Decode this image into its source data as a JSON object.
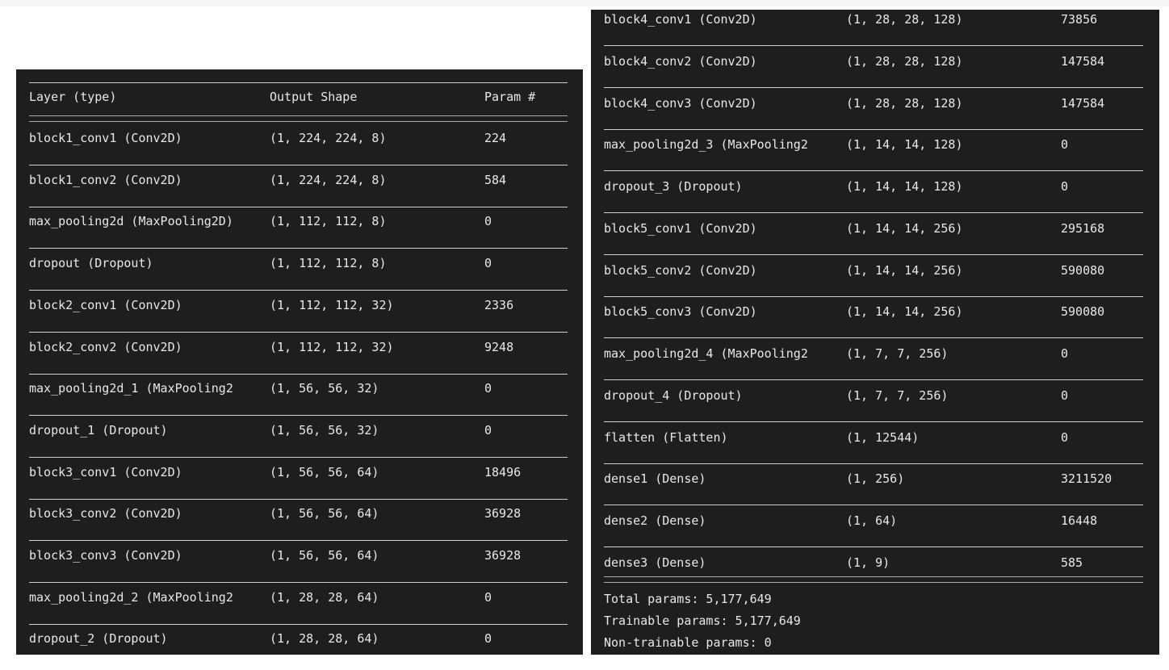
{
  "left_panel": {
    "headers": [
      "Layer (type)",
      "Output Shape",
      "Param #"
    ],
    "rows": [
      [
        "block1_conv1 (Conv2D)",
        "(1, 224, 224, 8)",
        "224"
      ],
      [
        "block1_conv2 (Conv2D)",
        "(1, 224, 224, 8)",
        "584"
      ],
      [
        "max_pooling2d (MaxPooling2D)",
        "(1, 112, 112, 8)",
        "0"
      ],
      [
        "dropout (Dropout)",
        "(1, 112, 112, 8)",
        "0"
      ],
      [
        "block2_conv1 (Conv2D)",
        "(1, 112, 112, 32)",
        "2336"
      ],
      [
        "block2_conv2 (Conv2D)",
        "(1, 112, 112, 32)",
        "9248"
      ],
      [
        "max_pooling2d_1 (MaxPooling2",
        "(1, 56, 56, 32)",
        "0"
      ],
      [
        "dropout_1 (Dropout)",
        "(1, 56, 56, 32)",
        "0"
      ],
      [
        "block3_conv1 (Conv2D)",
        "(1, 56, 56, 64)",
        "18496"
      ],
      [
        "block3_conv2 (Conv2D)",
        "(1, 56, 56, 64)",
        "36928"
      ],
      [
        "block3_conv3 (Conv2D)",
        "(1, 56, 56, 64)",
        "36928"
      ],
      [
        "max_pooling2d_2 (MaxPooling2",
        "(1, 28, 28, 64)",
        "0"
      ],
      [
        "dropout_2 (Dropout)",
        "(1, 28, 28, 64)",
        "0"
      ]
    ]
  },
  "right_panel": {
    "rows": [
      [
        "block4_conv1 (Conv2D)",
        "(1, 28, 28, 128)",
        "73856"
      ],
      [
        "block4_conv2 (Conv2D)",
        "(1, 28, 28, 128)",
        "147584"
      ],
      [
        "block4_conv3 (Conv2D)",
        "(1, 28, 28, 128)",
        "147584"
      ],
      [
        "max_pooling2d_3 (MaxPooling2",
        "(1, 14, 14, 128)",
        "0"
      ],
      [
        "dropout_3 (Dropout)",
        "(1, 14, 14, 128)",
        "0"
      ],
      [
        "block5_conv1 (Conv2D)",
        "(1, 14, 14, 256)",
        "295168"
      ],
      [
        "block5_conv2 (Conv2D)",
        "(1, 14, 14, 256)",
        "590080"
      ],
      [
        "block5_conv3 (Conv2D)",
        "(1, 14, 14, 256)",
        "590080"
      ],
      [
        "max_pooling2d_4 (MaxPooling2",
        "(1, 7, 7, 256)",
        "0"
      ],
      [
        "dropout_4 (Dropout)",
        "(1, 7, 7, 256)",
        "0"
      ],
      [
        "flatten (Flatten)",
        "(1, 12544)",
        "0"
      ],
      [
        "dense1 (Dense)",
        "(1, 256)",
        "3211520"
      ],
      [
        "dense2 (Dense)",
        "(1, 64)",
        "16448"
      ],
      [
        "dense3 (Dense)",
        "(1, 9)",
        "585"
      ]
    ],
    "summary": {
      "total": "Total params: 5,177,649",
      "trainable": "Trainable params: 5,177,649",
      "non_trainable": "Non-trainable params: 0"
    }
  },
  "colors": {
    "panel_background": "#1e1e1e",
    "text": "#e8e8e8",
    "rule": "#cfcfcf"
  }
}
